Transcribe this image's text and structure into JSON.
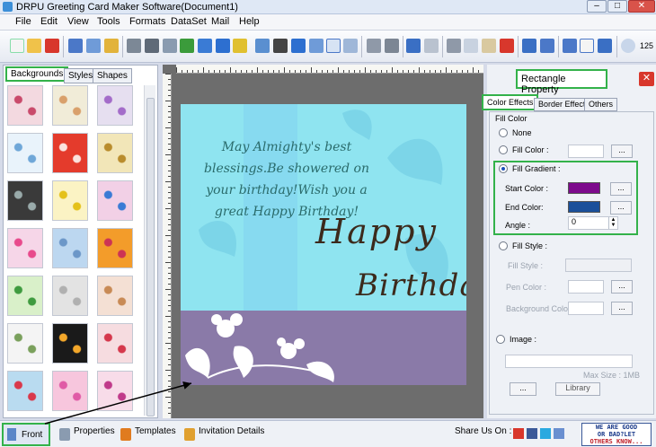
{
  "window": {
    "title": "DRPU Greeting Card Maker Software(Document1)",
    "min": "–",
    "max": "□",
    "close": "✕"
  },
  "menu": [
    "File",
    "Edit",
    "View",
    "Tools",
    "Formats",
    "DataSet",
    "Mail",
    "Help"
  ],
  "toolbar": {
    "zoom": "125"
  },
  "leftpanel": {
    "tabs": [
      "Backgrounds",
      "Styles",
      "Shapes"
    ]
  },
  "card": {
    "wish": "May Almighty's best blessings.Be showered on your birthday!Wish you a great Happy Birthday!",
    "happy": "Happy",
    "birthday": "Birthday"
  },
  "property": {
    "title": "Rectangle Property",
    "tabs": [
      "Color Effects",
      "Border Effect",
      "Others"
    ],
    "fill_color_group": "Fill Color",
    "none": "None",
    "fill_color": "Fill Color :",
    "fill_gradient": "Fill Gradient :",
    "start_color_label": "Start Color :",
    "start_color": "#7d0a8c",
    "end_color_label": "End Color:",
    "end_color": "#1a4f9a",
    "angle_label": "Angle :",
    "angle": "0",
    "fill_style": "Fill Style :",
    "fill_style_label": "Fill Style :",
    "pen_color": "Pen Color :",
    "background_color": "Background Color :",
    "image": "Image :",
    "max_size": "Max Size : 1MB",
    "dots": "...",
    "library": "Library"
  },
  "bottom": {
    "front": "Front",
    "properties": "Properties",
    "templates": "Templates",
    "invitation": "Invitation Details",
    "share": "Share Us On :",
    "badge_line1": "WE ARE GOOD",
    "badge_line2": "OR BAD?LET",
    "badge_line3": "OTHERS KNOW..."
  },
  "colors": {
    "accent_green": "#33b24a",
    "card_bg": "#8fe4f0",
    "card_bottom": "#8a7aa8"
  }
}
